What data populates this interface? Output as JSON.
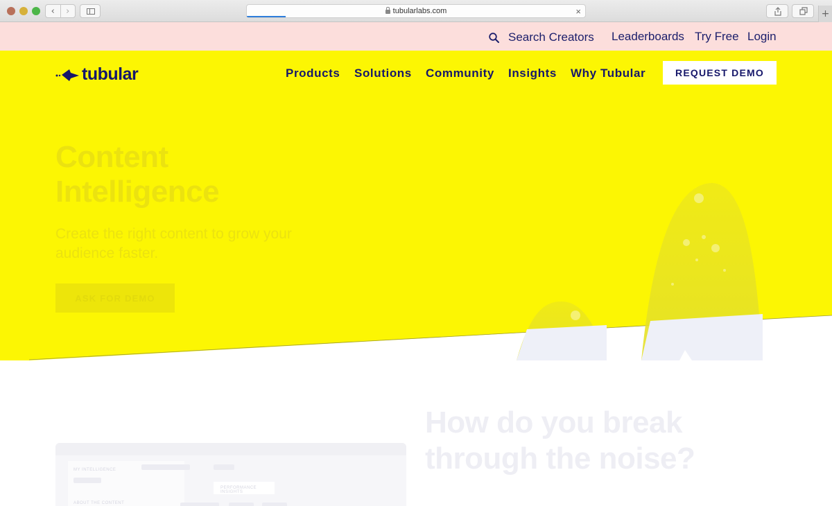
{
  "browser": {
    "url": "tubularlabs.com",
    "back_glyph": "‹",
    "forward_glyph": "›",
    "close_glyph": "×",
    "newtab_glyph": "+"
  },
  "utility_nav": {
    "search_label": "Search Creators",
    "leaderboards": "Leaderboards",
    "try_free": "Try Free",
    "login": "Login"
  },
  "brand": {
    "name": "tubular"
  },
  "main_nav": {
    "items": [
      "Products",
      "Solutions",
      "Community",
      "Insights",
      "Why Tubular"
    ],
    "cta": "REQUEST DEMO"
  },
  "hero": {
    "title_line1": "Content",
    "title_line2": "Intelligence",
    "subtitle": "Create the right content to grow your audience faster.",
    "cta": "ASK FOR DEMO"
  },
  "section": {
    "title_line1": "How do you break",
    "title_line2": "through the noise?"
  },
  "mockup": {
    "label1": "MY INTELLIGENCE",
    "label2": "PERFORMANCE INSIGHTS",
    "label3": "ABOUT THE CONTENT"
  },
  "colors": {
    "brand_navy": "#16176a",
    "hero_yellow": "#fcf603",
    "util_pink": "#fcdedc"
  }
}
